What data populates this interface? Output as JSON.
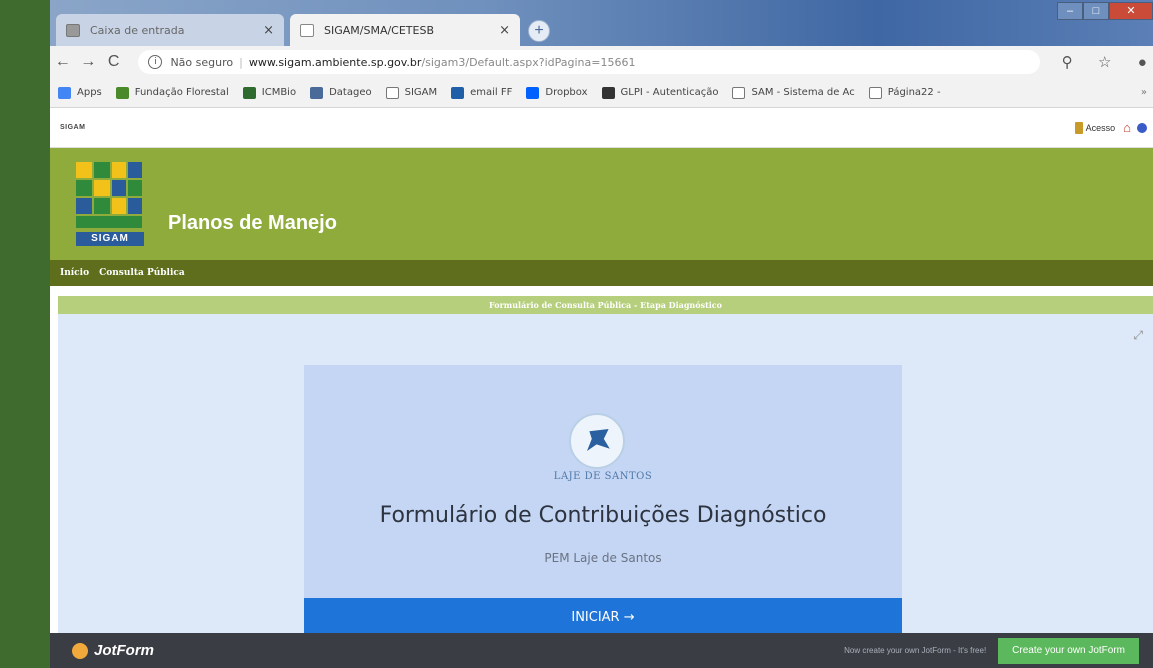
{
  "browser": {
    "tabs": [
      {
        "label": "Caixa de entrada",
        "close": "×"
      },
      {
        "label": "SIGAM/SMA/CETESB",
        "close": "×"
      }
    ],
    "new_tab": "+",
    "address": {
      "security": "Não seguro",
      "host": "www.sigam.ambiente.sp.gov.br",
      "path": "/sigam3/Default.aspx?idPagina=15661"
    },
    "bookmarks": [
      {
        "label": "Apps",
        "color": "#4285f4"
      },
      {
        "label": "Fundação Florestal",
        "color": "#4b8a2a"
      },
      {
        "label": "ICMBio",
        "color": "#2f6b2f"
      },
      {
        "label": "Datageo",
        "color": "#4a6a9a"
      },
      {
        "label": "SIGAM",
        "color": "#ffffff"
      },
      {
        "label": "email FF",
        "color": "#1f5fa8"
      },
      {
        "label": "Dropbox",
        "color": "#0061fe"
      },
      {
        "label": "GLPI - Autenticação",
        "color": "#333333"
      },
      {
        "label": "SAM - Sistema de Ac",
        "color": "#ffffff"
      },
      {
        "label": "Página22 -",
        "color": "#ffffff"
      }
    ],
    "bookmarks_more": "»"
  },
  "site": {
    "strip_label": "SIGAM",
    "acesso_label": "Acesso",
    "logo_text": "SIGAM",
    "title": "Planos de Manejo",
    "nav": [
      "Início",
      "Consulta Pública"
    ],
    "panel_title": "Formulário de Consulta Pública - Etapa Diagnóstico"
  },
  "form": {
    "org_name": "LAJE DE SANTOS",
    "title": "Formulário de Contribuições Diagnóstico",
    "subtitle": "PEM Laje de Santos",
    "start_label": "INICIAR →"
  },
  "jotform": {
    "brand": "JotForm",
    "promo": "Now create your own JotForm - It's free!",
    "cta": "Create your own JotForm"
  },
  "colors": {
    "header_green": "#8eab3c",
    "nav_olive": "#5e6e1c",
    "button_blue": "#1e74d8",
    "cta_green": "#5cb85c"
  }
}
